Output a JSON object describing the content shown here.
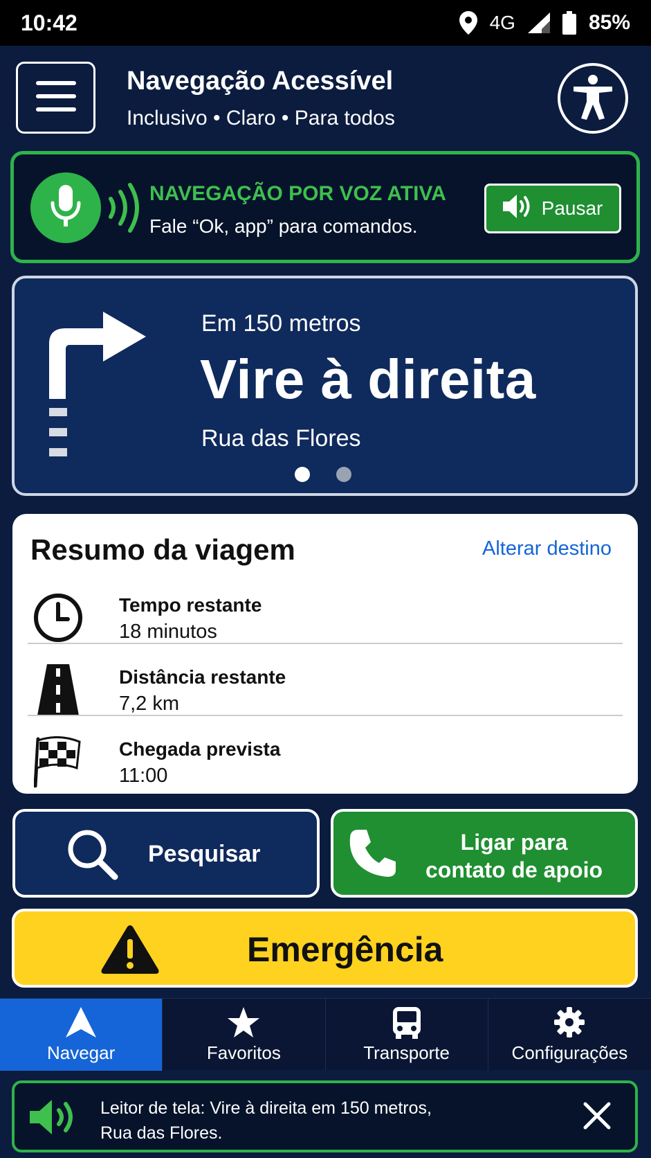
{
  "status_bar": {
    "time": "10:42",
    "network": "4G",
    "battery": "85%"
  },
  "header": {
    "title": "Navegação Acessível",
    "subtitle": "Inclusivo • Claro • Para todos",
    "menu_icon": "hamburger-menu-icon",
    "accessibility_icon": "accessibility-person-icon"
  },
  "voice": {
    "title": "NAVEGAÇÃO POR VOZ ATIVA",
    "description": "Fale “Ok, app” para comandos.",
    "pause_label": "Pausar",
    "color": "#2eb34a"
  },
  "direction": {
    "distance": "Em 150 metros",
    "instruction": "Vire à direita",
    "street": "Rua das Flores",
    "page_count": 2,
    "active_page": 1
  },
  "trip": {
    "title": "Resumo da viagem",
    "change_link": "Alterar destino",
    "rows": [
      {
        "icon": "clock-icon",
        "label": "Tempo restante",
        "value": "18 minutos"
      },
      {
        "icon": "road-icon",
        "label": "Distância restante",
        "value": "7,2 km"
      },
      {
        "icon": "checkered-flag-icon",
        "label": "Chegada prevista",
        "value": "11:00"
      }
    ]
  },
  "actions": {
    "search_label": "Pesquisar",
    "call_label_1": "Ligar para",
    "call_label_2": "contato de apoio",
    "emergency_label": "Emergência"
  },
  "bottom_nav": {
    "items": [
      {
        "label": "Navegar",
        "icon": "navigation-arrow-icon",
        "active": true
      },
      {
        "label": "Favoritos",
        "icon": "star-icon",
        "active": false
      },
      {
        "label": "Transporte",
        "icon": "bus-icon",
        "active": false
      },
      {
        "label": "Configurações",
        "icon": "gear-icon",
        "active": false
      }
    ]
  },
  "screen_reader": {
    "line1": "Leitor de tela: Vire à direita em 150 metros,",
    "line2": "Rua das Flores."
  },
  "colors": {
    "background": "#0b1c3f",
    "card_blue": "#0f2a5c",
    "green": "#1f8f31",
    "accent_blue": "#1565d8",
    "emergency_yellow": "#ffd21f"
  }
}
